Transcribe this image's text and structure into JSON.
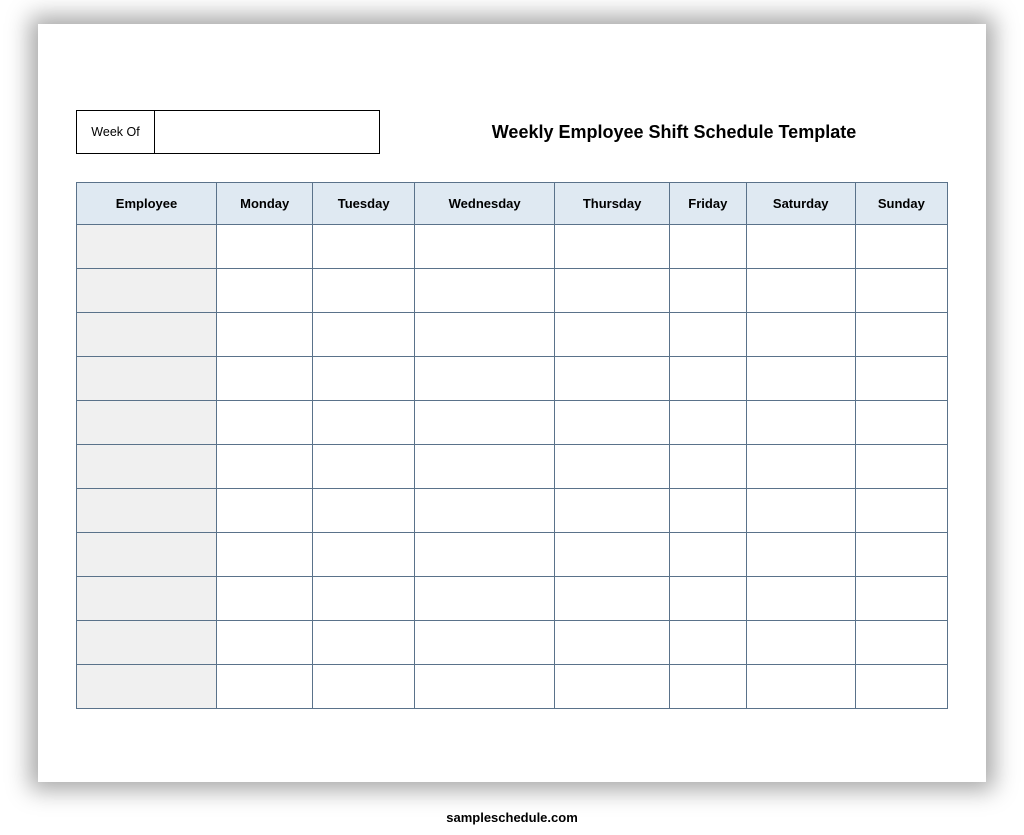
{
  "header": {
    "week_of_label": "Week Of",
    "week_of_value": "",
    "title": "Weekly Employee Shift Schedule Template"
  },
  "table": {
    "columns": [
      "Employee",
      "Monday",
      "Tuesday",
      "Wednesday",
      "Thursday",
      "Friday",
      "Saturday",
      "Sunday"
    ],
    "rows": [
      {
        "employee": "",
        "cells": [
          "",
          "",
          "",
          "",
          "",
          "",
          ""
        ]
      },
      {
        "employee": "",
        "cells": [
          "",
          "",
          "",
          "",
          "",
          "",
          ""
        ]
      },
      {
        "employee": "",
        "cells": [
          "",
          "",
          "",
          "",
          "",
          "",
          ""
        ]
      },
      {
        "employee": "",
        "cells": [
          "",
          "",
          "",
          "",
          "",
          "",
          ""
        ]
      },
      {
        "employee": "",
        "cells": [
          "",
          "",
          "",
          "",
          "",
          "",
          ""
        ]
      },
      {
        "employee": "",
        "cells": [
          "",
          "",
          "",
          "",
          "",
          "",
          ""
        ]
      },
      {
        "employee": "",
        "cells": [
          "",
          "",
          "",
          "",
          "",
          "",
          ""
        ]
      },
      {
        "employee": "",
        "cells": [
          "",
          "",
          "",
          "",
          "",
          "",
          ""
        ]
      },
      {
        "employee": "",
        "cells": [
          "",
          "",
          "",
          "",
          "",
          "",
          ""
        ]
      },
      {
        "employee": "",
        "cells": [
          "",
          "",
          "",
          "",
          "",
          "",
          ""
        ]
      },
      {
        "employee": "",
        "cells": [
          "",
          "",
          "",
          "",
          "",
          "",
          ""
        ]
      }
    ]
  },
  "footer": {
    "attribution": "sampleschedule.com"
  }
}
